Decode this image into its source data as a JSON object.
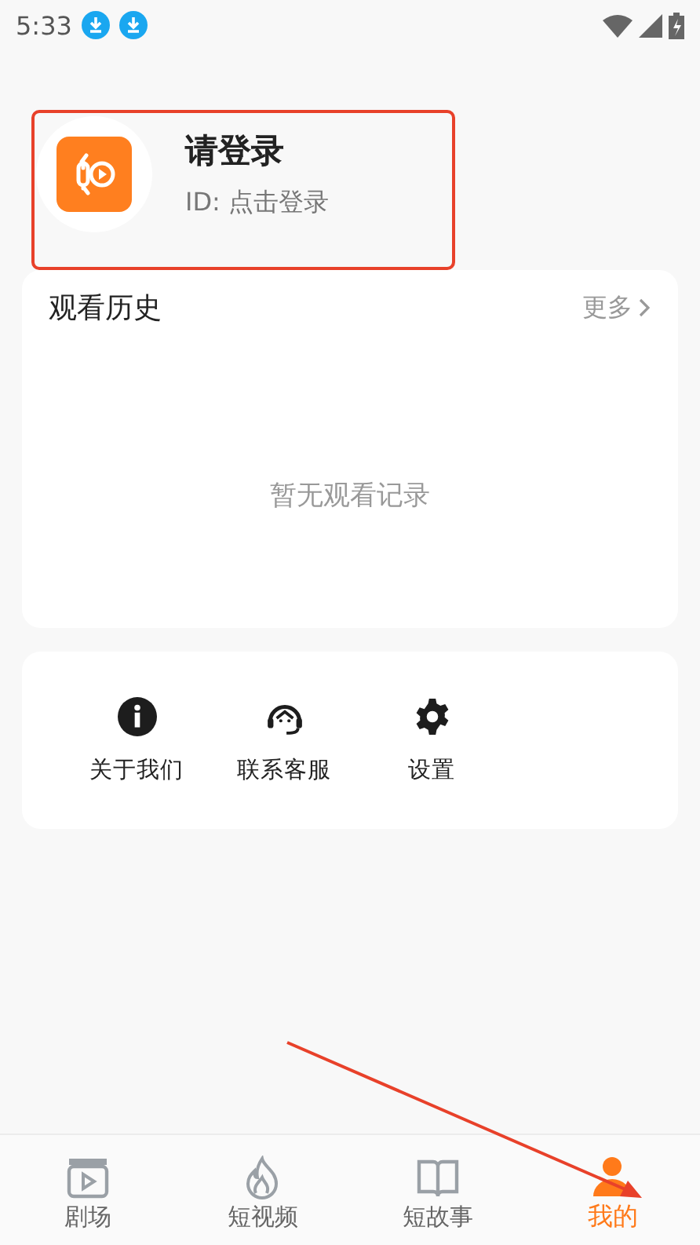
{
  "status_bar": {
    "time": "5:33"
  },
  "profile": {
    "title": "请登录",
    "id_text": "ID: 点击登录"
  },
  "history": {
    "title": "观看历史",
    "more": "更多",
    "empty_text": "暂无观看记录"
  },
  "services": [
    {
      "kind": "info",
      "label": "关于我们"
    },
    {
      "kind": "headset",
      "label": "联系客服"
    },
    {
      "kind": "gear",
      "label": "设置"
    }
  ],
  "tabs": [
    {
      "kind": "clapper",
      "label": "剧场",
      "selected": false
    },
    {
      "kind": "flame",
      "label": "短视频",
      "selected": false
    },
    {
      "kind": "book",
      "label": "短故事",
      "selected": false
    },
    {
      "kind": "person",
      "label": "我的",
      "selected": true
    }
  ]
}
